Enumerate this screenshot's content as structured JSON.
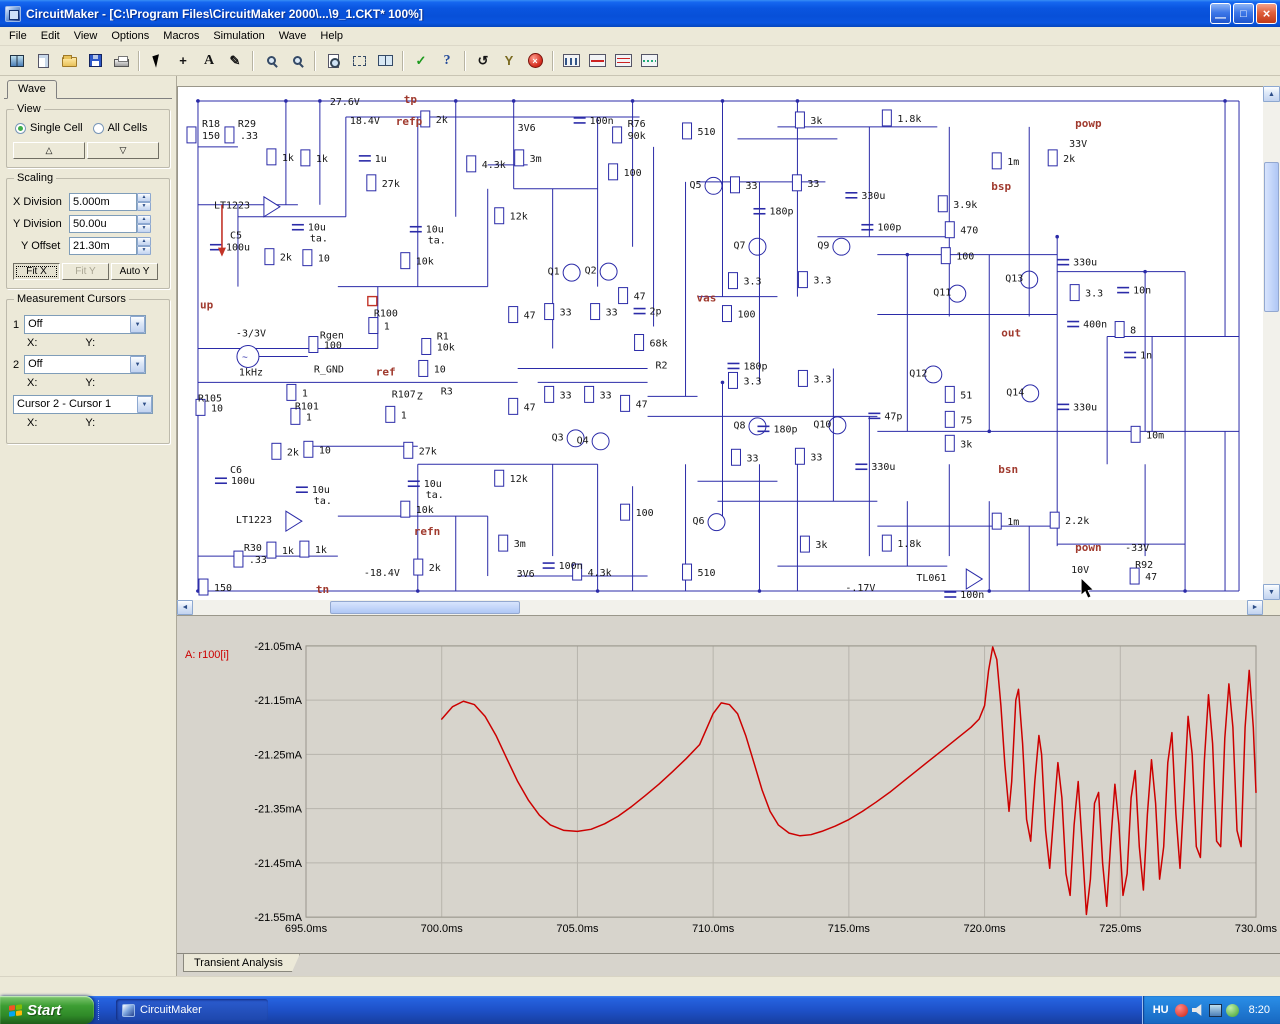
{
  "window": {
    "title": "CircuitMaker - [C:\\Program Files\\CircuitMaker 2000\\...\\9_1.CKT* 100%]",
    "minimize_glyph": "—",
    "maximize_glyph": "□",
    "close_glyph": "×"
  },
  "menu": {
    "items": [
      "File",
      "Edit",
      "View",
      "Options",
      "Macros",
      "Simulation",
      "Wave",
      "Help"
    ]
  },
  "toolbar": {
    "buttons": [
      "library-icon",
      "new-file-icon",
      "open-file-icon",
      "save-icon",
      "print-icon",
      "|",
      "cursor-tool-icon",
      "add-part-icon",
      "text-tool-icon",
      "wire-tool-icon",
      "|",
      "zoom-tool-icon",
      "zoom-window-icon",
      "|",
      "fit-page-icon",
      "zoom-area-icon",
      "split-view-icon",
      "|",
      "simulation-check-icon",
      "help-icon",
      "|",
      "reset-icon",
      "probe-tool-icon",
      "stop-icon",
      "|",
      "digital-display-icon",
      "waveform-display-icon",
      "scope-display-icon",
      "analysis-display-icon"
    ]
  },
  "sidebar": {
    "tab": "Wave",
    "view": {
      "label": "View",
      "options": [
        {
          "label": "Single Cell",
          "selected": true
        },
        {
          "label": "All Cells",
          "selected": false
        }
      ],
      "up_glyph": "△",
      "down_glyph": "▽"
    },
    "scaling": {
      "label": "Scaling",
      "fields": [
        {
          "label": "X Division",
          "value": "5.000m"
        },
        {
          "label": "Y Division",
          "value": "50.00u"
        },
        {
          "label": "Y Offset",
          "value": "21.30m"
        }
      ],
      "buttons": [
        {
          "label": "Fit X",
          "state": "active"
        },
        {
          "label": "Fit Y",
          "state": "disabled"
        },
        {
          "label": "Auto Y",
          "state": "normal"
        }
      ]
    },
    "cursors": {
      "label": "Measurement Cursors",
      "rows": [
        {
          "index": "1",
          "value": "Off"
        },
        {
          "index": "2",
          "value": "Off"
        }
      ],
      "diff_value": "Cursor 2 - Cursor 1",
      "x_label": "X:",
      "y_label": "Y:"
    }
  },
  "schematic": {
    "labels": [
      [
        "27.6V",
        152,
        14
      ],
      [
        "tp",
        226,
        12,
        "r"
      ],
      [
        "R18",
        24,
        36
      ],
      [
        "150",
        24,
        48
      ],
      [
        "R29",
        60,
        36
      ],
      [
        ".33",
        62,
        48
      ],
      [
        "18.4V",
        172,
        33
      ],
      [
        "refp",
        218,
        34,
        "r"
      ],
      [
        "2k",
        258,
        32
      ],
      [
        "1k",
        104,
        70
      ],
      [
        "1k",
        138,
        71
      ],
      [
        "1u",
        197,
        71
      ],
      [
        "27k",
        204,
        96
      ],
      [
        "LT1223",
        36,
        118
      ],
      [
        "C5",
        52,
        148
      ],
      [
        "100u",
        48,
        160
      ],
      [
        "10u",
        130,
        140
      ],
      [
        "ta.",
        132,
        151
      ],
      [
        "2k",
        102,
        170
      ],
      [
        "10",
        140,
        171
      ],
      [
        "10k",
        238,
        174
      ],
      [
        "10u",
        248,
        142
      ],
      [
        "ta.",
        250,
        153
      ],
      [
        "4.3k",
        304,
        77
      ],
      [
        "3V6",
        340,
        40
      ],
      [
        "3m",
        352,
        71
      ],
      [
        "100n",
        412,
        33
      ],
      [
        "R76",
        450,
        36
      ],
      [
        "90k",
        450,
        48
      ],
      [
        "510",
        520,
        44
      ],
      [
        "100",
        446,
        85
      ],
      [
        "Q5",
        512,
        97
      ],
      [
        "12k",
        332,
        129
      ],
      [
        "3k",
        633,
        33
      ],
      [
        "1.8k",
        720,
        31
      ],
      [
        "powp",
        898,
        36,
        "r"
      ],
      [
        "33V",
        892,
        56
      ],
      [
        "1m",
        830,
        74
      ],
      [
        "2k",
        886,
        71
      ],
      [
        "bsp",
        814,
        99,
        "r"
      ],
      [
        "33",
        568,
        98
      ],
      [
        "33",
        630,
        96
      ],
      [
        "180p",
        592,
        124
      ],
      [
        "330u",
        684,
        108
      ],
      [
        "3.9k",
        776,
        117
      ],
      [
        "100p",
        700,
        140
      ],
      [
        "470",
        783,
        143
      ],
      [
        "100",
        779,
        169
      ],
      [
        "Q7",
        556,
        158
      ],
      [
        "Q9",
        640,
        158
      ],
      [
        "Q13",
        828,
        191
      ],
      [
        "330u",
        896,
        175
      ],
      [
        "Q11",
        756,
        205
      ],
      [
        "3.3",
        566,
        194
      ],
      [
        "3.3",
        636,
        193
      ],
      [
        "3.3",
        908,
        206
      ],
      [
        "10n",
        956,
        203
      ],
      [
        "vas",
        519,
        211,
        "r"
      ],
      [
        "Q1",
        370,
        184
      ],
      [
        "Q2",
        407,
        183
      ],
      [
        "47",
        346,
        228
      ],
      [
        "33",
        382,
        225
      ],
      [
        "33",
        428,
        225
      ],
      [
        "47",
        456,
        209
      ],
      [
        "2p",
        472,
        224
      ],
      [
        "100",
        560,
        227
      ],
      [
        "68k",
        472,
        256
      ],
      [
        "R2",
        478,
        278
      ],
      [
        "out",
        824,
        246,
        "r"
      ],
      [
        "400n",
        906,
        237
      ],
      [
        "8",
        953,
        243
      ],
      [
        "1n",
        963,
        268
      ],
      [
        "up",
        22,
        218,
        "r"
      ],
      [
        "R100",
        196,
        226
      ],
      [
        "1",
        206,
        239
      ],
      [
        "R1",
        259,
        249
      ],
      [
        "10k",
        259,
        260
      ],
      [
        "-3/3V",
        58,
        246
      ],
      [
        "Rgen",
        142,
        248
      ],
      [
        "100",
        146,
        258
      ],
      [
        "1kHz",
        61,
        285
      ],
      [
        "R_GND",
        136,
        282
      ],
      [
        "ref",
        198,
        285,
        "r"
      ],
      [
        "10",
        256,
        282
      ],
      [
        "R3",
        263,
        304
      ],
      [
        "R105",
        20,
        311
      ],
      [
        "10",
        33,
        321
      ],
      [
        "1",
        124,
        306
      ],
      [
        "R101",
        117,
        319
      ],
      [
        "1",
        128,
        330
      ],
      [
        "R107",
        214,
        307
      ],
      [
        "1",
        223,
        328
      ],
      [
        "Z",
        239,
        309
      ],
      [
        "180p",
        566,
        279
      ],
      [
        "3.3",
        566,
        294
      ],
      [
        "3.3",
        636,
        292
      ],
      [
        "Q12",
        732,
        286
      ],
      [
        "Q8",
        556,
        338
      ],
      [
        "Q10",
        636,
        337
      ],
      [
        "180p",
        596,
        342
      ],
      [
        "47",
        346,
        320
      ],
      [
        "33",
        382,
        308
      ],
      [
        "33",
        422,
        308
      ],
      [
        "47",
        458,
        317
      ],
      [
        "Q3",
        374,
        350
      ],
      [
        "Q4",
        399,
        353
      ],
      [
        "47p",
        707,
        329
      ],
      [
        "51",
        783,
        308
      ],
      [
        "75",
        783,
        333
      ],
      [
        "3k",
        783,
        357
      ],
      [
        "bsn",
        821,
        383,
        "r"
      ],
      [
        "Q14",
        829,
        305
      ],
      [
        "330u",
        896,
        320
      ],
      [
        "10m",
        969,
        348
      ],
      [
        "33",
        569,
        371
      ],
      [
        "33",
        633,
        370
      ],
      [
        "330u",
        694,
        380
      ],
      [
        "C6",
        52,
        383
      ],
      [
        "100u",
        53,
        394
      ],
      [
        "2k",
        109,
        365
      ],
      [
        "10",
        141,
        363
      ],
      [
        "27k",
        241,
        364
      ],
      [
        "10u",
        134,
        403
      ],
      [
        "ta.",
        136,
        414
      ],
      [
        "10u",
        246,
        397
      ],
      [
        "ta.",
        248,
        408
      ],
      [
        "10k",
        238,
        423
      ],
      [
        "LT1223",
        58,
        433
      ],
      [
        "R30",
        66,
        461
      ],
      [
        ".33",
        71,
        473
      ],
      [
        "1k",
        104,
        464
      ],
      [
        "1k",
        137,
        463
      ],
      [
        "-18.4V",
        186,
        486
      ],
      [
        "2k",
        251,
        481
      ],
      [
        "refn",
        236,
        445,
        "r"
      ],
      [
        "3m",
        336,
        457
      ],
      [
        "3V6",
        339,
        487
      ],
      [
        "100n",
        381,
        479
      ],
      [
        "4.3k",
        410,
        486
      ],
      [
        "510",
        520,
        486
      ],
      [
        "100",
        458,
        426
      ],
      [
        "Q6",
        515,
        434
      ],
      [
        "12k",
        332,
        392
      ],
      [
        "3k",
        638,
        458
      ],
      [
        "1.8k",
        720,
        457
      ],
      [
        "pown",
        898,
        461,
        "r"
      ],
      [
        "-33V",
        948,
        461
      ],
      [
        "1m",
        830,
        435
      ],
      [
        "2.2k",
        888,
        434
      ],
      [
        "10V",
        894,
        483
      ],
      [
        "TL061",
        739,
        491
      ],
      [
        "R92",
        958,
        478
      ],
      [
        "47",
        968,
        490
      ],
      [
        "-.17V",
        668,
        501
      ],
      [
        "100n",
        783,
        508
      ],
      [
        "150",
        36,
        501
      ],
      [
        "tn",
        138,
        503,
        "r"
      ]
    ]
  },
  "chart_data": {
    "type": "line",
    "series": [
      {
        "name": "A: r100[i]"
      }
    ],
    "color": "#CC0000",
    "xlim": [
      695,
      730
    ],
    "ylim": [
      -21.55,
      -21.05
    ],
    "x_tick_values": [
      695,
      700,
      705,
      710,
      715,
      720,
      725,
      730
    ],
    "x_ticks": [
      "695.0ms",
      "700.0ms",
      "705.0ms",
      "710.0ms",
      "715.0ms",
      "720.0ms",
      "725.0ms",
      "730.0ms"
    ],
    "y_tick_values": [
      -21.05,
      -21.15,
      -21.25,
      -21.35,
      -21.45,
      -21.55
    ],
    "y_ticks": [
      "-21.05mA",
      "-21.15mA",
      "-21.25mA",
      "-21.35mA",
      "-21.45mA",
      "-21.55mA"
    ],
    "points": [
      [
        700.0,
        -21.185
      ],
      [
        700.4,
        -21.162
      ],
      [
        700.8,
        -21.152
      ],
      [
        701.2,
        -21.158
      ],
      [
        701.6,
        -21.18
      ],
      [
        702.0,
        -21.215
      ],
      [
        702.4,
        -21.258
      ],
      [
        702.8,
        -21.3
      ],
      [
        703.2,
        -21.335
      ],
      [
        703.6,
        -21.362
      ],
      [
        704.0,
        -21.38
      ],
      [
        704.5,
        -21.39
      ],
      [
        705.0,
        -21.392
      ],
      [
        705.5,
        -21.388
      ],
      [
        706.0,
        -21.378
      ],
      [
        706.5,
        -21.364
      ],
      [
        707.0,
        -21.346
      ],
      [
        707.5,
        -21.326
      ],
      [
        708.0,
        -21.305
      ],
      [
        708.5,
        -21.282
      ],
      [
        709.0,
        -21.258
      ],
      [
        709.5,
        -21.232
      ],
      [
        710.0,
        -21.175
      ],
      [
        710.3,
        -21.155
      ],
      [
        710.6,
        -21.158
      ],
      [
        710.9,
        -21.175
      ],
      [
        711.2,
        -21.215
      ],
      [
        711.5,
        -21.265
      ],
      [
        711.8,
        -21.315
      ],
      [
        712.1,
        -21.355
      ],
      [
        712.4,
        -21.38
      ],
      [
        712.8,
        -21.395
      ],
      [
        713.2,
        -21.4
      ],
      [
        713.6,
        -21.398
      ],
      [
        714.0,
        -21.392
      ],
      [
        714.5,
        -21.382
      ],
      [
        715.0,
        -21.37
      ],
      [
        715.5,
        -21.355
      ],
      [
        716.0,
        -21.338
      ],
      [
        716.5,
        -21.32
      ],
      [
        717.0,
        -21.3
      ],
      [
        717.5,
        -21.28
      ],
      [
        718.0,
        -21.26
      ],
      [
        718.5,
        -21.24
      ],
      [
        719.0,
        -21.22
      ],
      [
        719.5,
        -21.2
      ],
      [
        719.8,
        -21.185
      ],
      [
        720.0,
        -21.16
      ],
      [
        720.15,
        -21.095
      ],
      [
        720.3,
        -21.052
      ],
      [
        720.45,
        -21.075
      ],
      [
        720.6,
        -21.16
      ],
      [
        720.75,
        -21.27
      ],
      [
        720.9,
        -21.355
      ],
      [
        721.0,
        -21.3
      ],
      [
        721.15,
        -21.15
      ],
      [
        721.25,
        -21.13
      ],
      [
        721.4,
        -21.23
      ],
      [
        721.55,
        -21.37
      ],
      [
        721.7,
        -21.41
      ],
      [
        721.85,
        -21.3
      ],
      [
        722.0,
        -21.215
      ],
      [
        722.1,
        -21.25
      ],
      [
        722.25,
        -21.39
      ],
      [
        722.4,
        -21.46
      ],
      [
        722.55,
        -21.36
      ],
      [
        722.7,
        -21.265
      ],
      [
        722.85,
        -21.33
      ],
      [
        723.0,
        -21.47
      ],
      [
        723.15,
        -21.51
      ],
      [
        723.3,
        -21.38
      ],
      [
        723.45,
        -21.3
      ],
      [
        723.6,
        -21.42
      ],
      [
        723.75,
        -21.545
      ],
      [
        723.9,
        -21.48
      ],
      [
        724.05,
        -21.34
      ],
      [
        724.2,
        -21.32
      ],
      [
        724.35,
        -21.45
      ],
      [
        724.5,
        -21.53
      ],
      [
        724.65,
        -21.41
      ],
      [
        724.8,
        -21.305
      ],
      [
        724.95,
        -21.38
      ],
      [
        725.1,
        -21.51
      ],
      [
        725.25,
        -21.47
      ],
      [
        725.4,
        -21.33
      ],
      [
        725.55,
        -21.28
      ],
      [
        725.7,
        -21.42
      ],
      [
        725.85,
        -21.5
      ],
      [
        726.0,
        -21.36
      ],
      [
        726.15,
        -21.26
      ],
      [
        726.3,
        -21.34
      ],
      [
        726.45,
        -21.48
      ],
      [
        726.6,
        -21.42
      ],
      [
        726.75,
        -21.265
      ],
      [
        726.9,
        -21.21
      ],
      [
        727.05,
        -21.36
      ],
      [
        727.2,
        -21.46
      ],
      [
        727.35,
        -21.32
      ],
      [
        727.5,
        -21.18
      ],
      [
        727.65,
        -21.25
      ],
      [
        727.8,
        -21.42
      ],
      [
        727.95,
        -21.44
      ],
      [
        728.1,
        -21.26
      ],
      [
        728.25,
        -21.14
      ],
      [
        728.4,
        -21.23
      ],
      [
        728.55,
        -21.41
      ],
      [
        728.7,
        -21.42
      ],
      [
        728.85,
        -21.22
      ],
      [
        729.0,
        -21.12
      ],
      [
        729.15,
        -21.2
      ],
      [
        729.3,
        -21.39
      ],
      [
        729.45,
        -21.42
      ],
      [
        729.6,
        -21.2
      ],
      [
        729.75,
        -21.095
      ],
      [
        729.9,
        -21.2
      ],
      [
        730.0,
        -21.32
      ]
    ]
  },
  "wave_panel": {
    "tab": "Transient Analysis"
  },
  "taskbar": {
    "start_label": "Start",
    "task_label": "CircuitMaker",
    "tray": {
      "language": "HU",
      "time": "8:20",
      "icons": [
        "security-icon",
        "volume-icon",
        "network-icon",
        "messenger-icon"
      ]
    }
  }
}
